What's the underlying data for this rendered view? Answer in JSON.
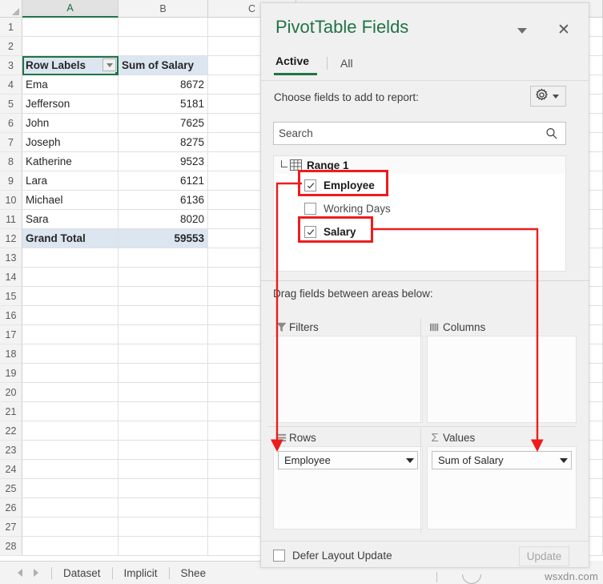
{
  "spreadsheet": {
    "columns": [
      "A",
      "B",
      "C"
    ],
    "active_column": "A",
    "row_count": 28,
    "active_cell": "A3",
    "cells": {
      "a3": "Row Labels",
      "b3": "Sum of Salary",
      "a12": "Grand Total",
      "b12": "59553"
    },
    "rows": [
      {
        "num": "1",
        "a": "",
        "b": ""
      },
      {
        "num": "2",
        "a": "",
        "b": ""
      },
      {
        "num": "3",
        "a": "Row Labels",
        "b": "Sum of Salary"
      },
      {
        "num": "4",
        "a": "Ema",
        "b": "8672"
      },
      {
        "num": "5",
        "a": "Jefferson",
        "b": "5181"
      },
      {
        "num": "6",
        "a": "John",
        "b": "7625"
      },
      {
        "num": "7",
        "a": "Joseph",
        "b": "8275"
      },
      {
        "num": "8",
        "a": "Katherine",
        "b": "9523"
      },
      {
        "num": "9",
        "a": "Lara",
        "b": "6121"
      },
      {
        "num": "10",
        "a": "Michael",
        "b": "6136"
      },
      {
        "num": "11",
        "a": "Sara",
        "b": "8020"
      },
      {
        "num": "12",
        "a": "Grand Total",
        "b": "59553"
      },
      {
        "num": "13",
        "a": "",
        "b": ""
      },
      {
        "num": "14",
        "a": "",
        "b": ""
      },
      {
        "num": "15",
        "a": "",
        "b": ""
      },
      {
        "num": "16",
        "a": "",
        "b": ""
      },
      {
        "num": "17",
        "a": "",
        "b": ""
      },
      {
        "num": "18",
        "a": "",
        "b": ""
      },
      {
        "num": "19",
        "a": "",
        "b": ""
      },
      {
        "num": "20",
        "a": "",
        "b": ""
      },
      {
        "num": "21",
        "a": "",
        "b": ""
      },
      {
        "num": "22",
        "a": "",
        "b": ""
      },
      {
        "num": "23",
        "a": "",
        "b": ""
      },
      {
        "num": "24",
        "a": "",
        "b": ""
      },
      {
        "num": "25",
        "a": "",
        "b": ""
      },
      {
        "num": "26",
        "a": "",
        "b": ""
      },
      {
        "num": "27",
        "a": "",
        "b": ""
      },
      {
        "num": "28",
        "a": "",
        "b": ""
      }
    ]
  },
  "sheet_tabs": {
    "items": [
      {
        "label": "Dataset",
        "active": false
      },
      {
        "label": "Implicit",
        "active": false
      },
      {
        "label": "Shee",
        "active": false
      }
    ]
  },
  "pivot_panel": {
    "title": "PivotTable Fields",
    "menu_icon": "chevron-down-icon",
    "close_icon": "close-icon",
    "tabs": [
      {
        "label": "Active",
        "active": true
      },
      {
        "label": "All",
        "active": false
      }
    ],
    "choose_label": "Choose fields to add to report:",
    "tools_icon": "gear-icon",
    "search": {
      "placeholder": "Search",
      "value": "",
      "icon": "search-icon"
    },
    "field_list": {
      "group_label": "Range 1",
      "group_icon": "table-icon",
      "fields": [
        {
          "label": "Employee",
          "checked": true,
          "highlighted": true
        },
        {
          "label": "Working Days",
          "checked": false,
          "highlighted": false
        },
        {
          "label": "Salary",
          "checked": true,
          "highlighted": true
        }
      ]
    },
    "drag_label": "Drag fields between areas below:",
    "areas": [
      {
        "name": "Filters",
        "icon": "filter-icon",
        "chips": []
      },
      {
        "name": "Columns",
        "icon": "columns-icon",
        "chips": []
      },
      {
        "name": "Rows",
        "icon": "rows-icon",
        "chips": [
          "Employee"
        ]
      },
      {
        "name": "Values",
        "icon": "sigma-icon",
        "chips": [
          "Sum of Salary"
        ]
      }
    ],
    "defer_label": "Defer Layout Update",
    "defer_checked": false,
    "update_label": "Update",
    "update_disabled": true
  },
  "annotations": {
    "highlight_color": "#ee1c1c",
    "arrows": [
      {
        "from": "Employee",
        "to": "Rows"
      },
      {
        "from": "Salary",
        "to": "Values"
      }
    ]
  },
  "watermark": "wsxdn.com",
  "colors": {
    "excel_green": "#217346",
    "header_fill": "#dce6f1",
    "annotation_red": "#ee1c1c"
  }
}
